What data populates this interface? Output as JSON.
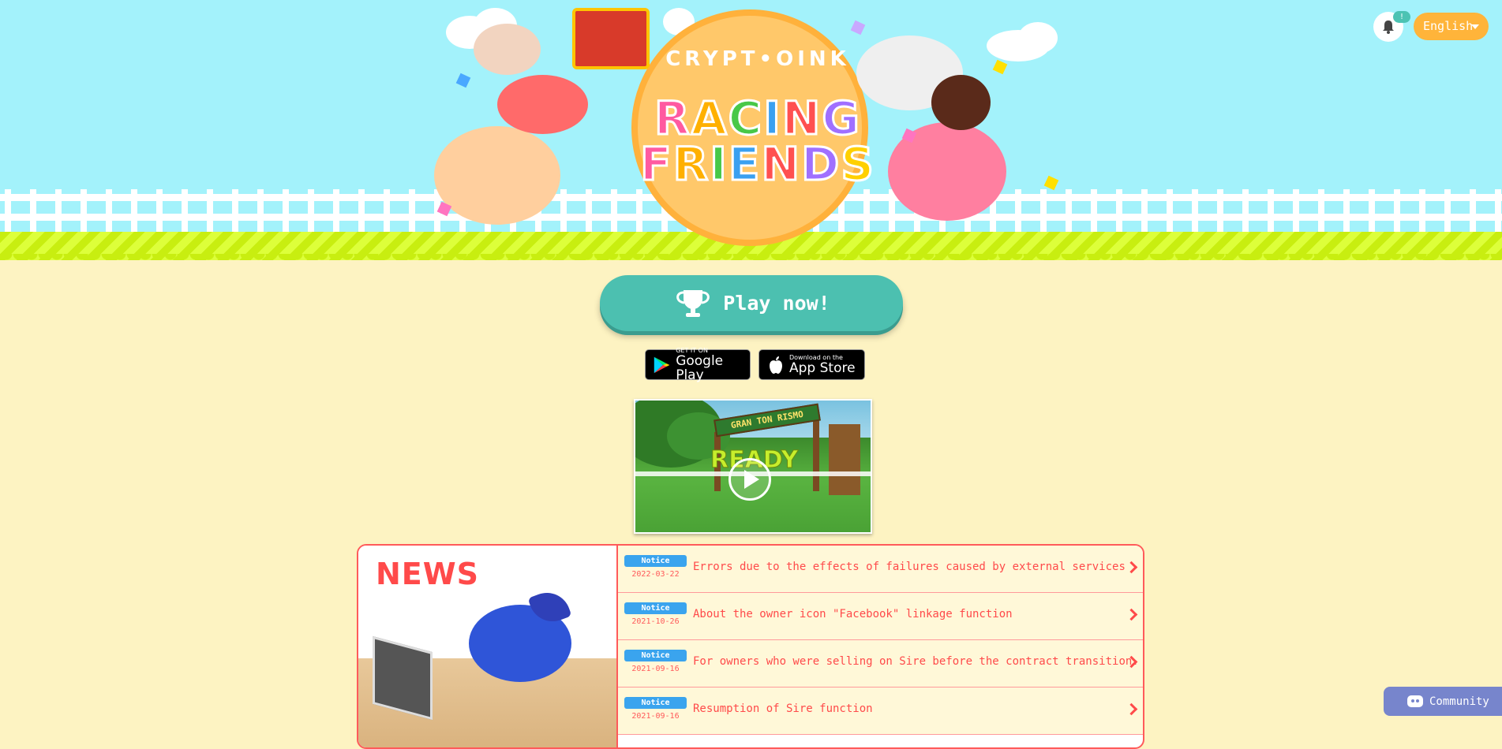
{
  "header": {
    "logo_top": "CRYPT•OINK",
    "logo_line1": [
      "R",
      "A",
      "C",
      "I",
      "N",
      "G"
    ],
    "logo_line2": [
      "F",
      "R",
      "I",
      "E",
      "N",
      "D",
      "S"
    ],
    "logo_colors": [
      "#ff5aa0",
      "#ffb000",
      "#48c848",
      "#3aa0f0",
      "#ff5050",
      "#a070ff",
      "#ffd000"
    ],
    "notification_count": "!",
    "language": "English"
  },
  "main": {
    "play_label": "Play now!",
    "google_play": {
      "small": "GET IT ON",
      "big": "Google Play"
    },
    "app_store": {
      "small": "Download on the",
      "big": "App Store"
    },
    "video": {
      "sign_text": "GRAN TON RISMO",
      "overlay_text": "READY"
    }
  },
  "news": {
    "title": "NEWS",
    "items": [
      {
        "tag": "Notice",
        "date": "2022-03-22",
        "text": "Errors due to the effects of failures caused by external services"
      },
      {
        "tag": "Notice",
        "date": "2021-10-26",
        "text": "About the owner icon \"Facebook\" linkage function"
      },
      {
        "tag": "Notice",
        "date": "2021-09-16",
        "text": "For owners who were selling on Sire before the contract transition."
      },
      {
        "tag": "Notice",
        "date": "2021-09-16",
        "text": "Resumption of Sire function"
      }
    ]
  },
  "community_label": "Community",
  "colors": {
    "sky": "#a3f2fb",
    "page_bg": "#fdf3c2",
    "accent_teal": "#4cc0b0",
    "news_red": "#ff4a4a",
    "lang_orange": "#ffb43a",
    "discord": "#7785cc"
  }
}
